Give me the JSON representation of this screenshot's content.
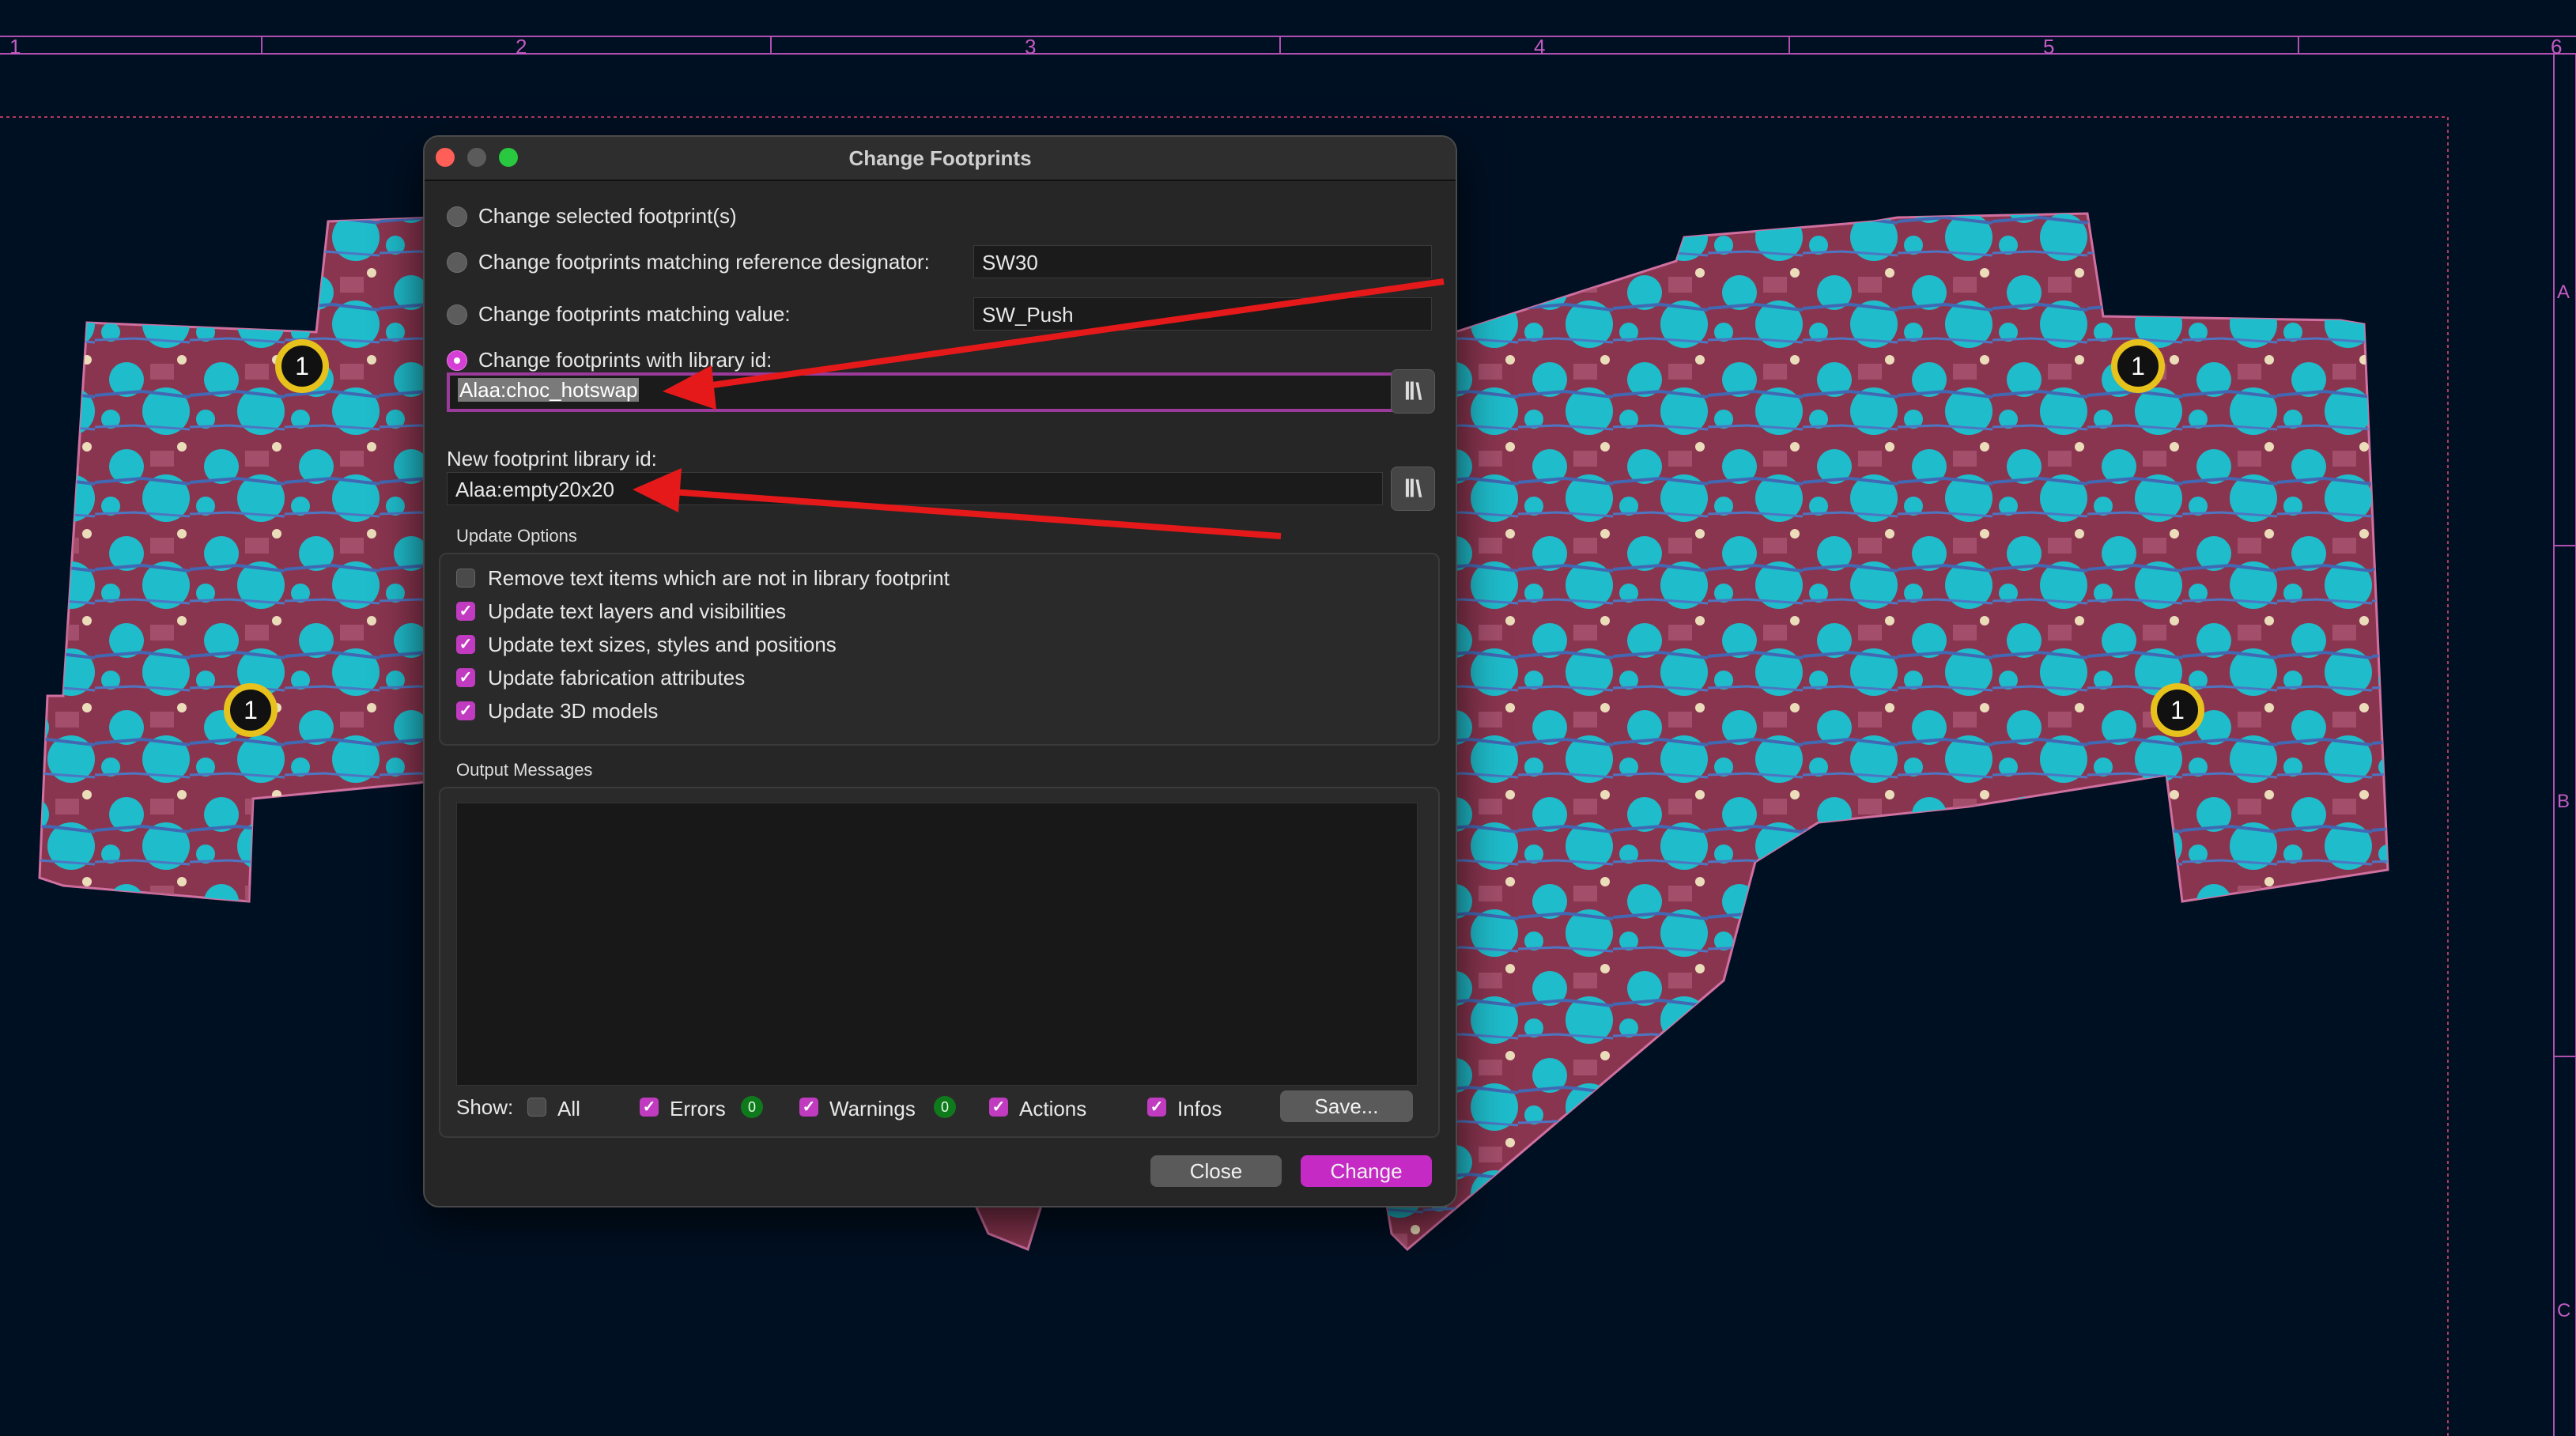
{
  "ruler": {
    "numbers": [
      "1",
      "2",
      "3",
      "4",
      "5",
      "6"
    ],
    "letters": [
      "A",
      "B",
      "C"
    ]
  },
  "pcb": {
    "marker_label": "1",
    "colors": {
      "board": "#8a3550",
      "board_edge": "#d070a0",
      "pad": "#19c3d1",
      "trace": "#3e6bb8",
      "marker": "#e8c21c"
    }
  },
  "dialog": {
    "title": "Change Footprints",
    "options": {
      "selected": "Change selected footprint(s)",
      "by_reference": "Change footprints matching reference designator:",
      "by_value": "Change footprints matching value:",
      "by_library": "Change footprints with library id:"
    },
    "reference_value": "SW30",
    "value_value": "SW_Push",
    "library_id_value": "Alaa:choc_hotswap",
    "new_library_label": "New footprint library id:",
    "new_library_value": "Alaa:empty20x20",
    "library_button_icon": "library-browser-icon",
    "update_options_label": "Update Options",
    "update_options": [
      {
        "label": "Remove text items which are not in library footprint",
        "checked": false
      },
      {
        "label": "Update text layers and visibilities",
        "checked": true
      },
      {
        "label": "Update text sizes, styles and positions",
        "checked": true
      },
      {
        "label": "Update fabrication attributes",
        "checked": true
      },
      {
        "label": "Update 3D models",
        "checked": true
      }
    ],
    "output_label": "Output Messages",
    "show_label": "Show:",
    "filters": {
      "all": "All",
      "errors": "Errors",
      "errors_count": "0",
      "warnings": "Warnings",
      "warnings_count": "0",
      "actions": "Actions",
      "infos": "Infos"
    },
    "save_button": "Save...",
    "close_button": "Close",
    "change_button": "Change",
    "accent_color": "#c52ac5"
  }
}
